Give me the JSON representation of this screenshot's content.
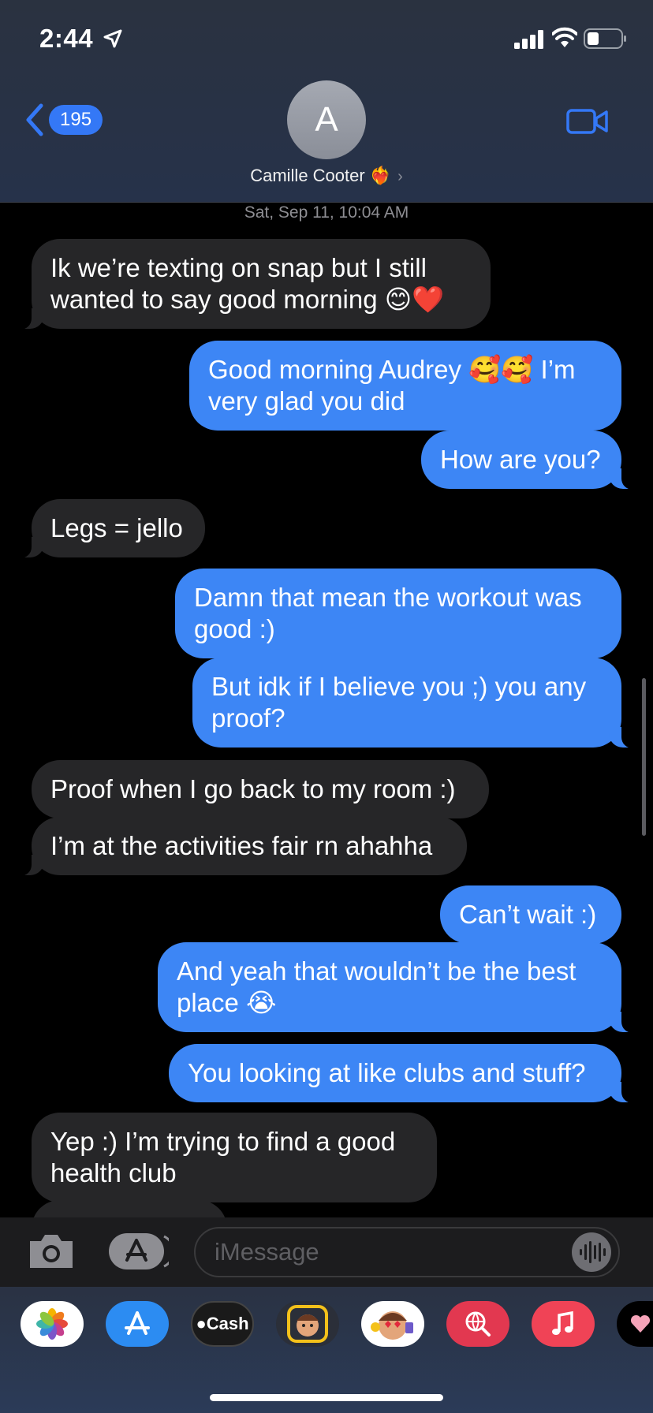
{
  "status_bar": {
    "time": "2:44"
  },
  "header": {
    "back_count": "195",
    "avatar_initial": "A",
    "contact_name": "Camille Cooter",
    "contact_emoji": "❤️‍🔥",
    "chevron": "›"
  },
  "conversation": {
    "timestamp": "Sat, Sep 11, 10:04 AM",
    "messages": [
      {
        "dir": "in",
        "text": "Ik we’re texting on snap but I still wanted to say good morning 😊❤️"
      },
      {
        "dir": "out",
        "text": "Good morning Audrey 🥰🥰 I’m very glad you did"
      },
      {
        "dir": "out",
        "text": "How are you?"
      },
      {
        "dir": "in",
        "text": "Legs = jello"
      },
      {
        "dir": "out",
        "text": "Damn that mean the workout was good :)"
      },
      {
        "dir": "out",
        "text": "But idk if I believe you ;) you any proof?"
      },
      {
        "dir": "in",
        "text": "Proof when I go back to my room :)"
      },
      {
        "dir": "in",
        "text": "I’m at the activities fair rn ahahha"
      },
      {
        "dir": "out",
        "text": "Can’t wait :)"
      },
      {
        "dir": "out",
        "text": "And yeah that wouldn’t be the best place 😭"
      },
      {
        "dir": "out",
        "text": "You looking at like clubs and stuff?"
      },
      {
        "dir": "in",
        "text": "Yep :) I’m trying to find a good health club"
      }
    ]
  },
  "input_bar": {
    "placeholder": "iMessage"
  },
  "app_drawer": {
    "apps": [
      {
        "name": "photos-app-icon",
        "label": ""
      },
      {
        "name": "app-store-app-icon",
        "label": ""
      },
      {
        "name": "apple-cash-app-icon",
        "label": "Cash"
      },
      {
        "name": "memoji-app-icon",
        "label": ""
      },
      {
        "name": "memoji-stickers-app-icon",
        "label": ""
      },
      {
        "name": "web-search-app-icon",
        "label": ""
      },
      {
        "name": "music-app-icon",
        "label": ""
      },
      {
        "name": "fitness-app-icon",
        "label": ""
      }
    ]
  },
  "colors": {
    "outgoing_bubble": "#3d86f5",
    "incoming_bubble": "#262628",
    "accent": "#3478f6"
  }
}
